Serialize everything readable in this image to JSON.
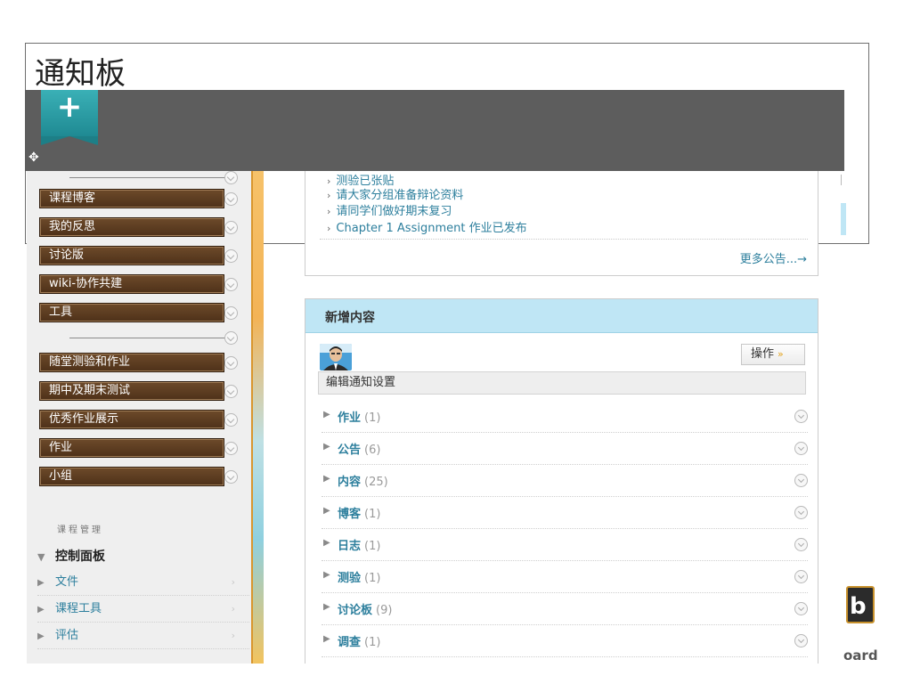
{
  "page": {
    "title": "通知板"
  },
  "sidebar": {
    "group1": [
      {
        "label": "课程博客"
      },
      {
        "label": "我的反思"
      },
      {
        "label": "讨论版"
      },
      {
        "label": "wiki-协作共建"
      },
      {
        "label": "工具"
      }
    ],
    "group2": [
      {
        "label": "随堂测验和作业"
      },
      {
        "label": "期中及期末测试"
      },
      {
        "label": "优秀作业展示"
      },
      {
        "label": "作业"
      },
      {
        "label": "小组"
      }
    ],
    "management_label": "课程管理",
    "control_panel": "控制面板",
    "control_items": [
      {
        "label": "文件"
      },
      {
        "label": "课程工具"
      },
      {
        "label": "评估"
      }
    ]
  },
  "announcements": {
    "links": [
      {
        "label": "测验已张贴"
      },
      {
        "label": "请大家分组准备辩论资料"
      },
      {
        "label": "请同学们做好期末复习"
      },
      {
        "label": "Chapter 1 Assignment 作业已发布"
      }
    ],
    "more_label": "更多公告..."
  },
  "new_content": {
    "title": "新增内容",
    "ops_label": "操作",
    "edit_label": "编辑通知设置",
    "categories": [
      {
        "name": "作业",
        "count": "(1)"
      },
      {
        "name": "公告",
        "count": "(6)"
      },
      {
        "name": "内容",
        "count": "(25)"
      },
      {
        "name": "博客",
        "count": "(1)"
      },
      {
        "name": "日志",
        "count": "(1)"
      },
      {
        "name": "测验",
        "count": "(1)"
      },
      {
        "name": "讨论板",
        "count": "(9)"
      },
      {
        "name": "调查",
        "count": "(1)"
      }
    ]
  },
  "brand": {
    "logo_text": "oard",
    "logo_glyph": "b"
  },
  "colors": {
    "menu_brown": "#5a3a1f",
    "link_blue": "#2d7f9d",
    "header_blue": "#bfe6f5",
    "banner_gray": "#5d5d5d",
    "teal": "#2a9ca5"
  },
  "icons": {
    "add": "plus-icon",
    "move": "move-icon"
  }
}
